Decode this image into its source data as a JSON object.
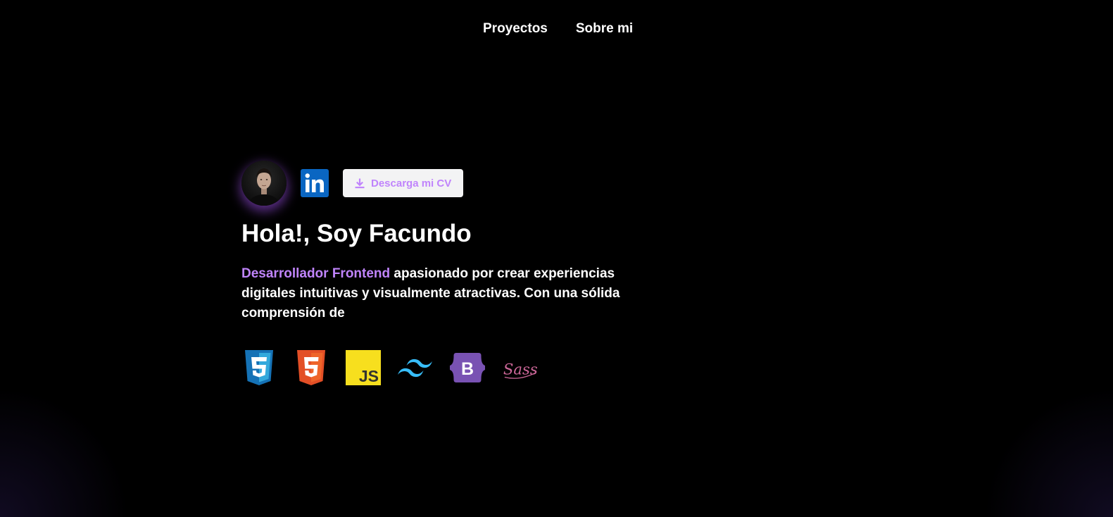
{
  "nav": {
    "items": [
      {
        "label": "Proyectos"
      },
      {
        "label": "Sobre mi"
      }
    ]
  },
  "hero": {
    "cv_button_label": "Descarga mi CV",
    "greeting": "Hola!, Soy Facundo",
    "role": "Desarrollador Frontend",
    "bio_text": " apasionado por crear experiencias digitales intuitivas y visualmente atractivas. Con una sólida comprensión de",
    "linkedin_text": "in"
  },
  "tech_icons": [
    {
      "name": "css3-icon",
      "text": "3"
    },
    {
      "name": "html5-icon",
      "text": "5"
    },
    {
      "name": "javascript-icon",
      "text": "JS"
    },
    {
      "name": "tailwind-icon"
    },
    {
      "name": "bootstrap-icon",
      "text": "B"
    },
    {
      "name": "sass-icon",
      "text": "Sass"
    }
  ],
  "colors": {
    "accent": "#c084fc",
    "background": "#000000",
    "linkedin": "#0a66c2",
    "css3": "#1572b6",
    "html5": "#e34f26",
    "javascript": "#f7df1e",
    "tailwind": "#38bdf8",
    "bootstrap": "#7952b3",
    "sass": "#cd6799"
  }
}
